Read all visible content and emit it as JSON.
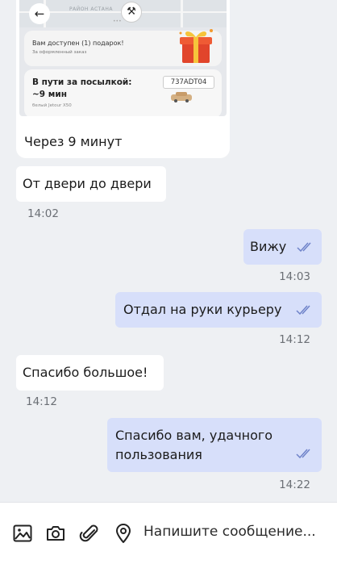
{
  "map_card": {
    "street_label": "РАЙОН АСТАНА",
    "gift_banner_title": "Вам доступен (1) подарок!",
    "gift_banner_sub": "За оформленный заказ",
    "delivery_status": "В пути за посылкой:",
    "delivery_eta": "~9 мин",
    "car_model": "белый Jetour X50",
    "plate_number": "737ADT04",
    "caption": "Через 9 минут"
  },
  "messages": [
    {
      "direction": "in",
      "text": "От двери до двери",
      "time": "14:02"
    },
    {
      "direction": "out",
      "text": "Вижу",
      "time": "14:03",
      "read": true
    },
    {
      "direction": "out",
      "text": "Отдал на руки курьеру",
      "time": "14:12",
      "read": true
    },
    {
      "direction": "in",
      "text": "Спасибо большое!",
      "time": "14:12"
    },
    {
      "direction": "out",
      "text": "Спасибо вам, удачного\nпользования",
      "time": "14:22",
      "read": true
    }
  ],
  "composer": {
    "placeholder": "Напишите сообщение...",
    "icons": [
      "image-icon",
      "camera-icon",
      "paperclip-icon",
      "location-icon"
    ]
  },
  "colors": {
    "outgoing_bubble": "#d7dffa",
    "incoming_bubble": "#ffffff",
    "chat_background": "#eef0f3",
    "read_check": "#6f83c9"
  }
}
